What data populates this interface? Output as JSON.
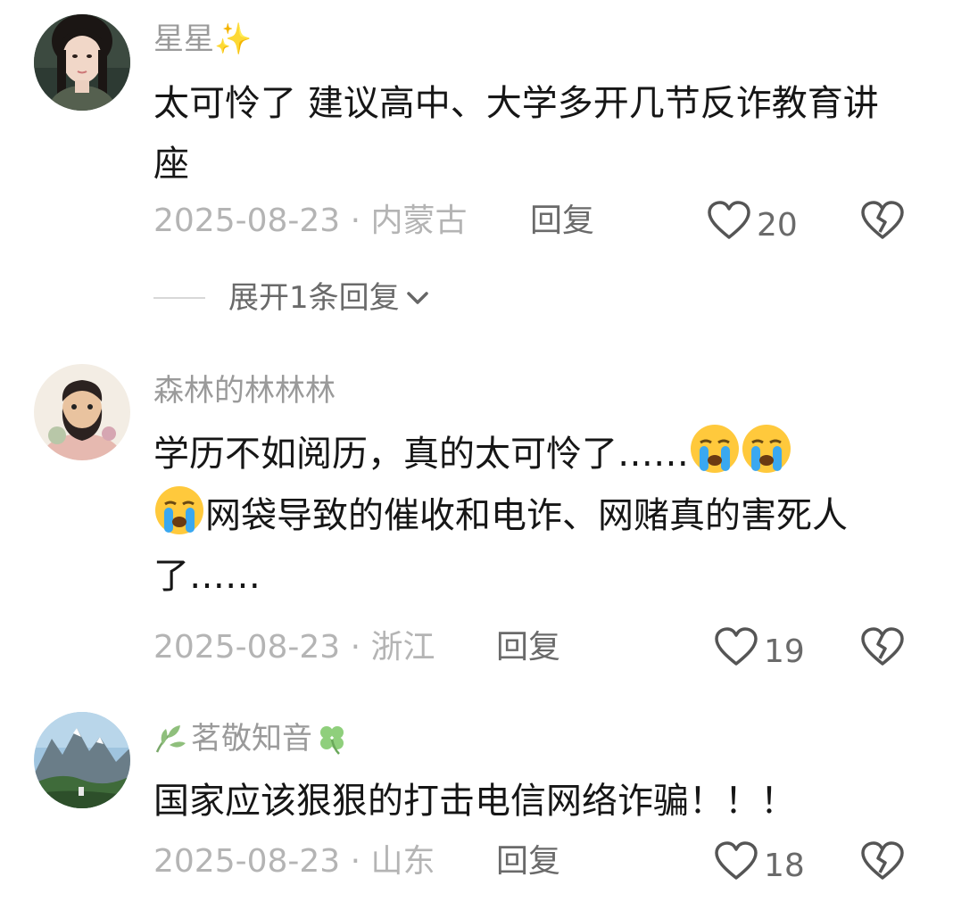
{
  "comments": [
    {
      "username": "星星✨",
      "text": "太可怜了 建议高中、大学多开几节反诈教育讲座",
      "meta": "2025-08-23 · 内蒙古",
      "reply_label": "回复",
      "likes": "20",
      "expand_label": "展开1条回复"
    },
    {
      "username": "森林的林林林",
      "text_part1": "学历不如阅历，真的太可怜了……",
      "text_part2": "网袋导致的催收和电诈、网赌真的害死人了……",
      "meta": "2025-08-23 · 浙江",
      "reply_label": "回复",
      "likes": "19"
    },
    {
      "username": "茗敬知音",
      "text": "国家应该狠狠的打击电信网络诈骗！！！",
      "meta": "2025-08-23 · 山东",
      "reply_label": "回复",
      "likes": "18"
    }
  ],
  "icons": {
    "like": "heart-outline-icon",
    "dislike": "broken-heart-icon",
    "expand": "chevron-down-icon",
    "emoji": "loudly-crying-face-emoji"
  },
  "colors": {
    "username": "#9a9a9a",
    "text": "#161616",
    "meta": "#b4b4b4",
    "action": "#6a6a6a"
  }
}
